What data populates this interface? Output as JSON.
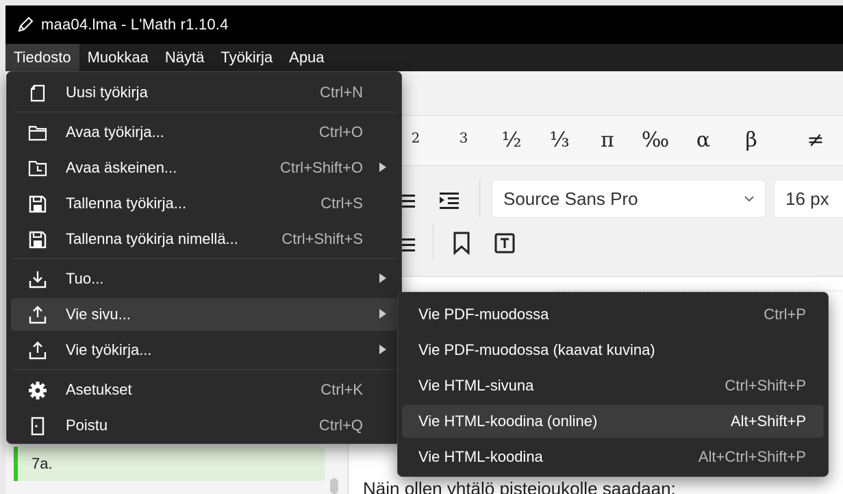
{
  "window": {
    "title": "maa04.lma - L'Math r1.10.4"
  },
  "menubar": {
    "items": [
      "Tiedosto",
      "Muokkaa",
      "Näytä",
      "Työkirja",
      "Apua"
    ],
    "active": "Tiedosto"
  },
  "file_menu": {
    "items": [
      {
        "label": "Uusi työkirja",
        "shortcut": "Ctrl+N",
        "icon": "new-page-icon"
      },
      {
        "label": "Avaa työkirja...",
        "shortcut": "Ctrl+O",
        "icon": "folder-icon"
      },
      {
        "label": "Avaa äskeinen...",
        "shortcut": "Ctrl+Shift+O",
        "icon": "recent-folder-icon",
        "submenu": true
      },
      {
        "label": "Tallenna työkirja...",
        "shortcut": "Ctrl+S",
        "icon": "save-icon"
      },
      {
        "label": "Tallenna työkirja nimellä...",
        "shortcut": "Ctrl+Shift+S",
        "icon": "save-as-icon"
      },
      {
        "label": "Tuo...",
        "shortcut": "",
        "icon": "import-icon",
        "submenu": true
      },
      {
        "label": "Vie sivu...",
        "shortcut": "",
        "icon": "export-icon",
        "submenu": true,
        "highlighted": true
      },
      {
        "label": "Vie työkirja...",
        "shortcut": "",
        "icon": "export-icon",
        "submenu": true
      },
      {
        "label": "Asetukset",
        "shortcut": "Ctrl+K",
        "icon": "gear-icon"
      },
      {
        "label": "Poistu",
        "shortcut": "Ctrl+Q",
        "icon": "exit-door-icon"
      }
    ]
  },
  "export_submenu": {
    "items": [
      {
        "label": "Vie PDF-muodossa",
        "shortcut": "Ctrl+P"
      },
      {
        "label": "Vie PDF-muodossa (kaavat kuvina)",
        "shortcut": ""
      },
      {
        "label": "Vie HTML-sivuna",
        "shortcut": "Ctrl+Shift+P"
      },
      {
        "label": "Vie HTML-koodina (online)",
        "shortcut": "Alt+Shift+P",
        "highlighted": true
      },
      {
        "label": "Vie HTML-koodina",
        "shortcut": "Alt+Ctrl+Shift+P"
      }
    ]
  },
  "symbols": [
    "2",
    "3",
    "½",
    "⅓",
    "π",
    "‰",
    "α",
    "β",
    "≠"
  ],
  "format_bar": {
    "font": "Source Sans Pro",
    "size": "16 px"
  },
  "sidebar": {
    "page_item": "7a."
  },
  "document": {
    "visible_text": "Näin ollen yhtälö pistejoukolle saadaan:"
  }
}
